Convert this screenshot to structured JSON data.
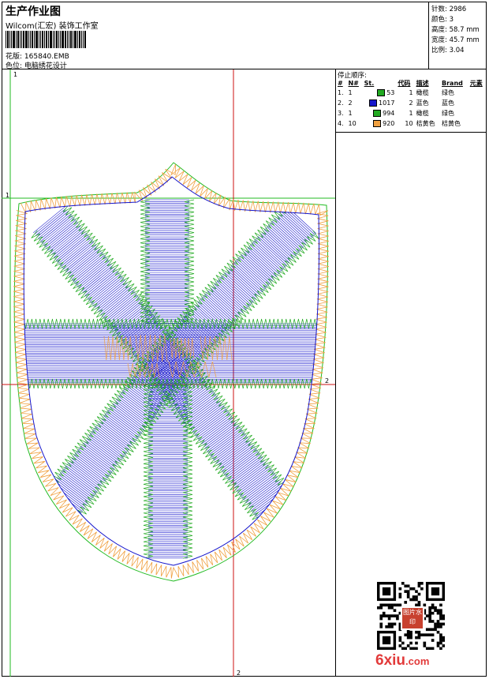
{
  "header": {
    "title": "生产作业图",
    "company": "Wilcom(汇宏) 装饰工作室",
    "design_file_label": "花版:",
    "design_file": "165840.EMB",
    "color_label": "色位:",
    "color_value": "电脑绣花设计"
  },
  "stats": {
    "stitches_label": "针数:",
    "stitches": "2986",
    "colors_label": "颜色:",
    "colors": "3",
    "height_label": "高度:",
    "height": "58.7 mm",
    "width_label": "宽度:",
    "width": "45.7 mm",
    "scale_label": "比例:",
    "scale": "3.04"
  },
  "stop_sequence": {
    "title": "停止顺序:",
    "headers": [
      "#",
      "N#",
      "St.",
      "代码",
      "描述",
      "Brand",
      "元素"
    ],
    "rows": [
      {
        "num": "1.",
        "n": "1",
        "swatch": "#22aa22",
        "st": "53",
        "code": "1",
        "desc": "橄榄",
        "brand": "绿色"
      },
      {
        "num": "2.",
        "n": "2",
        "swatch": "#1515cc",
        "st": "1017",
        "code": "2",
        "desc": "蓝色",
        "brand": "蓝色"
      },
      {
        "num": "3.",
        "n": "1",
        "swatch": "#22aa22",
        "st": "994",
        "code": "1",
        "desc": "橄榄",
        "brand": "绿色"
      },
      {
        "num": "4.",
        "n": "10",
        "swatch": "#f0a040",
        "st": "920",
        "code": "10",
        "desc": "桔黄色",
        "brand": "桔黄色"
      }
    ]
  },
  "design": {
    "guide_labels": {
      "top_left": "1",
      "left_mid": "1",
      "right_mid": "2",
      "bottom_mid": "2"
    },
    "colors": {
      "green": "#22aa22",
      "blue": "#1515cc",
      "orange": "#f0a040",
      "red_guide": "#cc1111",
      "green_guide": "#22bb22"
    }
  },
  "qr": {
    "stamp_text": "图片水印"
  },
  "watermark": {
    "text": "6xiu",
    "tld": ".com"
  }
}
